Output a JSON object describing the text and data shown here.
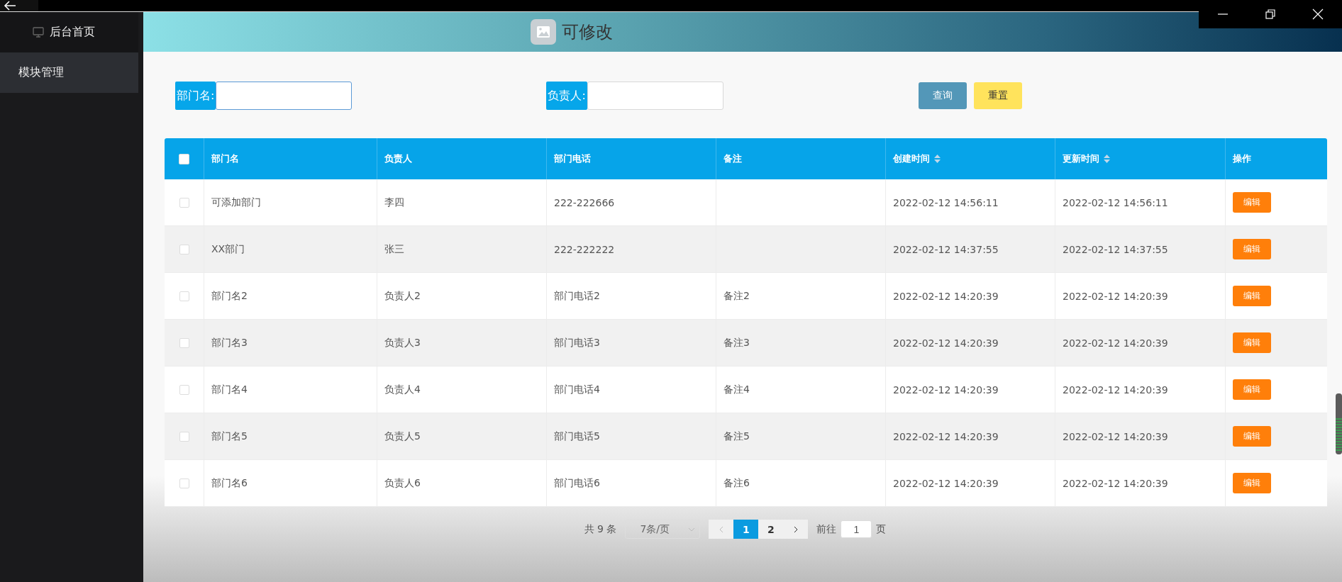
{
  "sidebar": {
    "items": [
      {
        "label": "后台首页",
        "kind": "home",
        "selected": false
      },
      {
        "label": "模块管理",
        "kind": "plain",
        "selected": true
      }
    ]
  },
  "header": {
    "title": "可修改"
  },
  "search": {
    "fields": [
      {
        "label": "部门名:",
        "focused": true
      },
      {
        "label": "负责人:",
        "focused": false
      }
    ],
    "buttons": [
      {
        "label": "查询",
        "kind": "primary"
      },
      {
        "label": "重置",
        "kind": "warning"
      }
    ]
  },
  "table": {
    "select_all_checked": false,
    "columns": [
      {
        "label": "部门名",
        "sortable": false
      },
      {
        "label": "负责人",
        "sortable": false
      },
      {
        "label": "部门电话",
        "sortable": false
      },
      {
        "label": "备注",
        "sortable": false
      },
      {
        "label": "创建时间",
        "sortable": true
      },
      {
        "label": "更新时间",
        "sortable": true
      },
      {
        "label": "操作",
        "sortable": false
      }
    ],
    "rows": [
      {
        "checked": false,
        "cells": [
          "可添加部门",
          "李四",
          "222-222666",
          "",
          "2022-02-12 14:56:11",
          "2022-02-12 14:56:11"
        ],
        "action": "编辑"
      },
      {
        "checked": false,
        "cells": [
          "XX部门",
          "张三",
          "222-222222",
          "",
          "2022-02-12 14:37:55",
          "2022-02-12 14:37:55"
        ],
        "action": "编辑"
      },
      {
        "checked": false,
        "cells": [
          "部门名2",
          "负责人2",
          "部门电话2",
          "备注2",
          "2022-02-12 14:20:39",
          "2022-02-12 14:20:39"
        ],
        "action": "编辑"
      },
      {
        "checked": false,
        "cells": [
          "部门名3",
          "负责人3",
          "部门电话3",
          "备注3",
          "2022-02-12 14:20:39",
          "2022-02-12 14:20:39"
        ],
        "action": "编辑"
      },
      {
        "checked": false,
        "cells": [
          "部门名4",
          "负责人4",
          "部门电话4",
          "备注4",
          "2022-02-12 14:20:39",
          "2022-02-12 14:20:39"
        ],
        "action": "编辑"
      },
      {
        "checked": false,
        "cells": [
          "部门名5",
          "负责人5",
          "部门电话5",
          "备注5",
          "2022-02-12 14:20:39",
          "2022-02-12 14:20:39"
        ],
        "action": "编辑"
      },
      {
        "checked": false,
        "cells": [
          "部门名6",
          "负责人6",
          "部门电话6",
          "备注6",
          "2022-02-12 14:20:39",
          "2022-02-12 14:20:39"
        ],
        "action": "编辑"
      }
    ]
  },
  "pagination": {
    "total": "共 9 条",
    "page_size": "7条/页",
    "pages": [
      {
        "label": "1",
        "selected": true
      },
      {
        "label": "2",
        "selected": false
      }
    ],
    "goto_label": "前往",
    "goto_value": "1",
    "goto_suffix": "页"
  }
}
